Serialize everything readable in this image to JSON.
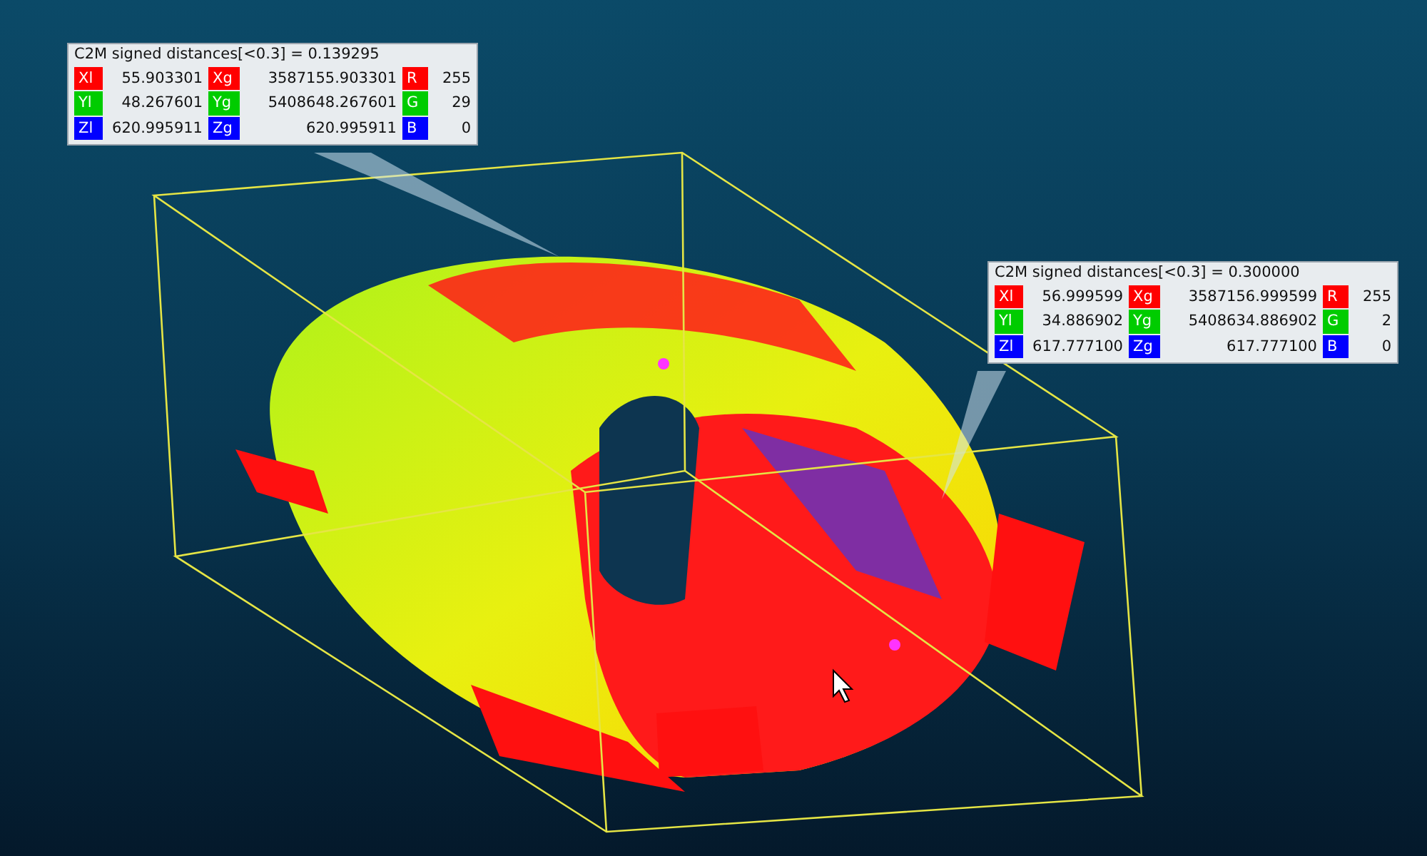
{
  "labels": [
    {
      "title": "C2M signed distances[<0.3] = 0.139295",
      "rows": [
        {
          "cells": [
            {
              "tag": "Xl",
              "color": "#ff0000",
              "value": "55.903301"
            },
            {
              "tag": "Xg",
              "color": "#ff0000",
              "value": "3587155.903301"
            },
            {
              "tag": "R",
              "color": "#ff0000",
              "value": "255"
            }
          ]
        },
        {
          "cells": [
            {
              "tag": "Yl",
              "color": "#00cc00",
              "value": "48.267601"
            },
            {
              "tag": "Yg",
              "color": "#00cc00",
              "value": "5408648.267601"
            },
            {
              "tag": "G",
              "color": "#00cc00",
              "value": "29"
            }
          ]
        },
        {
          "cells": [
            {
              "tag": "Zl",
              "color": "#0000ff",
              "value": "620.995911"
            },
            {
              "tag": "Zg",
              "color": "#0000ff",
              "value": "620.995911"
            },
            {
              "tag": "B",
              "color": "#0000ff",
              "value": "0"
            }
          ]
        }
      ]
    },
    {
      "title": "C2M signed distances[<0.3] = 0.300000",
      "rows": [
        {
          "cells": [
            {
              "tag": "Xl",
              "color": "#ff0000",
              "value": "56.999599"
            },
            {
              "tag": "Xg",
              "color": "#ff0000",
              "value": "3587156.999599"
            },
            {
              "tag": "R",
              "color": "#ff0000",
              "value": "255"
            }
          ]
        },
        {
          "cells": [
            {
              "tag": "Yl",
              "color": "#00cc00",
              "value": "34.886902"
            },
            {
              "tag": "Yg",
              "color": "#00cc00",
              "value": "5408634.886902"
            },
            {
              "tag": "G",
              "color": "#00cc00",
              "value": "2"
            }
          ]
        },
        {
          "cells": [
            {
              "tag": "Zl",
              "color": "#0000ff",
              "value": "617.777100"
            },
            {
              "tag": "Zg",
              "color": "#0000ff",
              "value": "617.777100"
            },
            {
              "tag": "B",
              "color": "#0000ff",
              "value": "0"
            }
          ]
        }
      ]
    }
  ]
}
